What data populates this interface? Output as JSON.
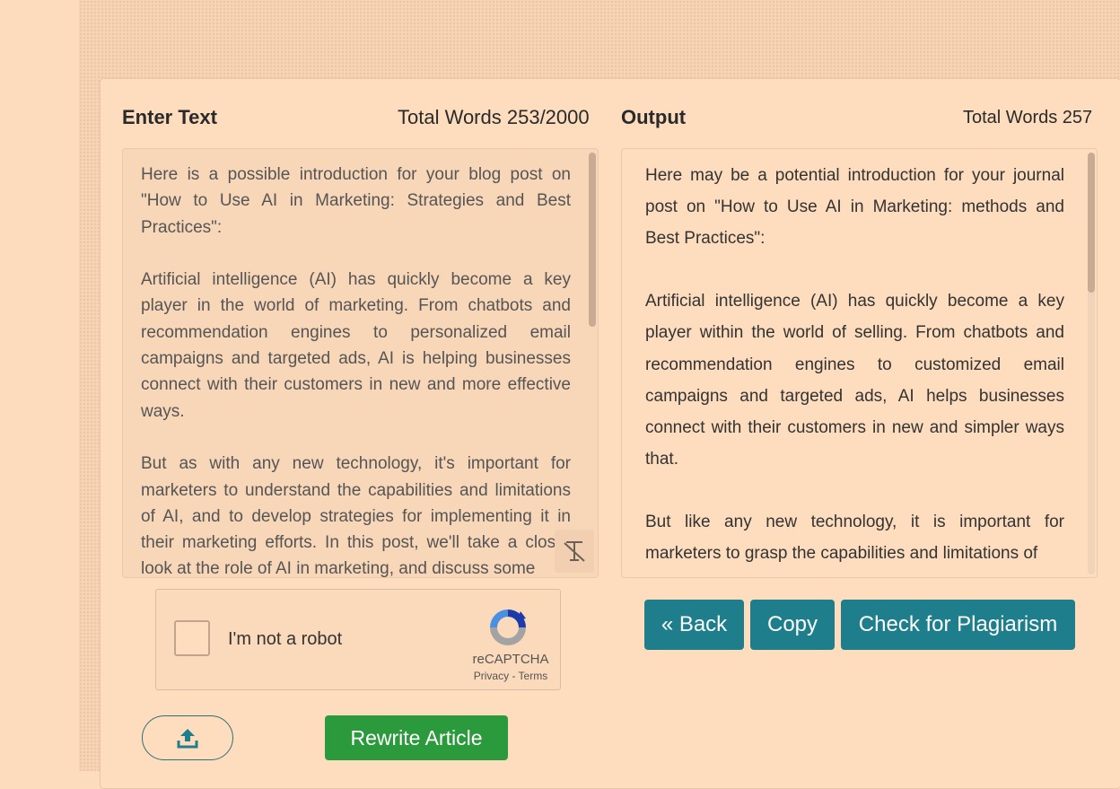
{
  "input": {
    "title": "Enter Text",
    "word_count": "Total Words 253/2000",
    "text": "Here is a possible introduction for your blog post on \"How to Use AI in Marketing: Strategies and Best Practices\":\n\nArtificial intelligence (AI) has quickly become a key player in the world of marketing. From chatbots and recommendation engines to personalized email campaigns and targeted ads, AI is helping businesses connect with their customers in new and more effective ways.\n\nBut as with any new technology, it's important for marketers to understand the capabilities and limitations of AI, and to develop strategies for implementing it in their marketing efforts. In this post, we'll take a closer look at the role of AI in marketing, and discuss some"
  },
  "output": {
    "title": "Output",
    "word_count": "Total Words 257",
    "text": "Here may be a potential introduction for your journal post on \"How to Use AI in Marketing: methods and Best Practices\":\n\nArtificial intelligence (AI) has quickly become a key player within the world of selling. From chatbots and recommendation engines to customized email campaigns and targeted ads, AI helps businesses connect with their customers in new and simpler ways that.\n\nBut like any new technology, it is important for marketers to grasp the capabilities and limitations of"
  },
  "recaptcha": {
    "label": "I'm not a robot",
    "brand": "reCAPTCHA",
    "links": "Privacy - Terms"
  },
  "buttons": {
    "back": "« Back",
    "copy": "Copy",
    "check": "Check for Plagiarism",
    "rewrite": "Rewrite Article"
  },
  "icons": {
    "clear": "clear-format-icon",
    "upload": "upload-icon",
    "recaptcha": "recaptcha-logo-icon"
  },
  "colors": {
    "teal_button": "#1e7e8c",
    "green_button": "#2b9a3c",
    "page_background": "#fddcbe"
  }
}
